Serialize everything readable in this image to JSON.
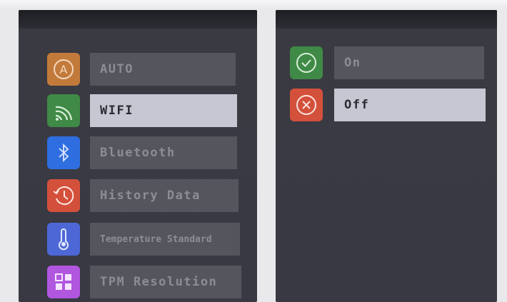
{
  "left_menu": {
    "items": [
      {
        "label": "AUTO",
        "icon": "auto-icon",
        "color": "#c27a3b",
        "active": false
      },
      {
        "label": "WIFI",
        "icon": "wifi-icon",
        "color": "#3f8a46",
        "active": true
      },
      {
        "label": "Bluetooth",
        "icon": "bluetooth-icon",
        "color": "#2f6ee0",
        "active": false
      },
      {
        "label": "History Data",
        "icon": "history-icon",
        "color": "#d3503b",
        "active": false
      },
      {
        "label": "Temperature Standard",
        "icon": "thermometer-icon",
        "color": "#4d68d6",
        "active": false
      },
      {
        "label": "TPM Resolution",
        "icon": "grid-icon",
        "color": "#b056df",
        "active": false
      }
    ]
  },
  "right_menu": {
    "items": [
      {
        "label": "On",
        "icon": "check-circle-icon",
        "color": "#3f8a46",
        "active": false
      },
      {
        "label": "Off",
        "icon": "x-circle-icon",
        "color": "#d3503b",
        "active": true
      }
    ]
  }
}
